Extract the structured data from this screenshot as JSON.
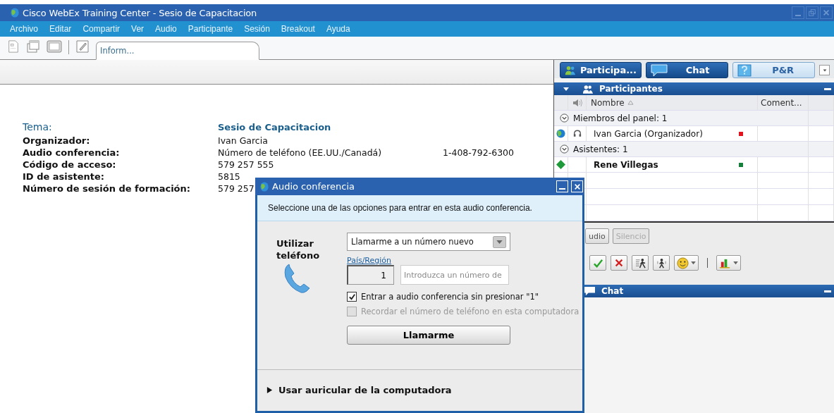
{
  "window": {
    "title": "Cisco WebEx Training Center - Sesio de Capacitacion"
  },
  "menu": [
    "Archivo",
    "Editar",
    "Compartir",
    "Ver",
    "Audio",
    "Participante",
    "Sesión",
    "Breakout",
    "Ayuda"
  ],
  "doc_tab": {
    "label": "Inform...",
    "selected": true
  },
  "session_info": {
    "topic_label": "Tema:",
    "topic": "Sesio de Capacitacion",
    "rows": [
      {
        "label": "Organizador:",
        "value": "Ivan Garcia"
      },
      {
        "label": "Audio conferencia:",
        "value": "Número de teléfono (EE.UU./Canadá)",
        "extra": "1-408-792-6300"
      },
      {
        "label": "Código de acceso:",
        "value": "579 257 555"
      },
      {
        "label": "ID de asistente:",
        "value": "5815"
      },
      {
        "label": "Número de sesión de formación:",
        "value": "579 257"
      }
    ]
  },
  "panel_tabs": [
    {
      "label": "Participa...",
      "kind": "participants",
      "selected": true
    },
    {
      "label": "Chat",
      "kind": "chat",
      "selected": true
    },
    {
      "label": "P&R",
      "kind": "qa",
      "selected": false
    }
  ],
  "participants": {
    "title": "Participantes",
    "expanded": true,
    "columns": [
      "Nombre",
      "Coment..."
    ],
    "groups": [
      {
        "label": "Miembros del panel: 1",
        "expanded": true,
        "children": [
          {
            "name": "Ivan Garcia (Organizador)",
            "kind": "organizer",
            "color": "#e0141e"
          }
        ]
      },
      {
        "label": "Asistentes: 1",
        "expanded": true,
        "children": [
          {
            "name": "Rene Villegas",
            "kind": "attendee",
            "color": "#16803a"
          }
        ]
      }
    ]
  },
  "audio_buttons": [
    {
      "label": "udio",
      "disabled": false
    },
    {
      "label": "Silencio",
      "disabled": true
    }
  ],
  "chat": {
    "title": "Chat"
  },
  "dialog": {
    "title": "Audio conferencia",
    "intro": "Seleccione una de las opciones para entrar en esta audio conferencia.",
    "heading": "Utilizar teléfono",
    "select": {
      "value": "Llamarme a un número nuevo"
    },
    "country_link": "País/Región",
    "country_code": {
      "value": "1"
    },
    "phone": {
      "placeholder": "Introduzca un número de"
    },
    "checkboxes": [
      {
        "label": "Entrar a audio conferencia sin presionar \"1\"",
        "checked": true,
        "disabled": false
      },
      {
        "label": "Recordar el número de teléfono en esta computadora",
        "checked": false,
        "disabled": true
      }
    ],
    "call_button": "Llamarme",
    "computer_audio": {
      "label": "Usar auricular de la computadora",
      "expanded": false
    }
  }
}
